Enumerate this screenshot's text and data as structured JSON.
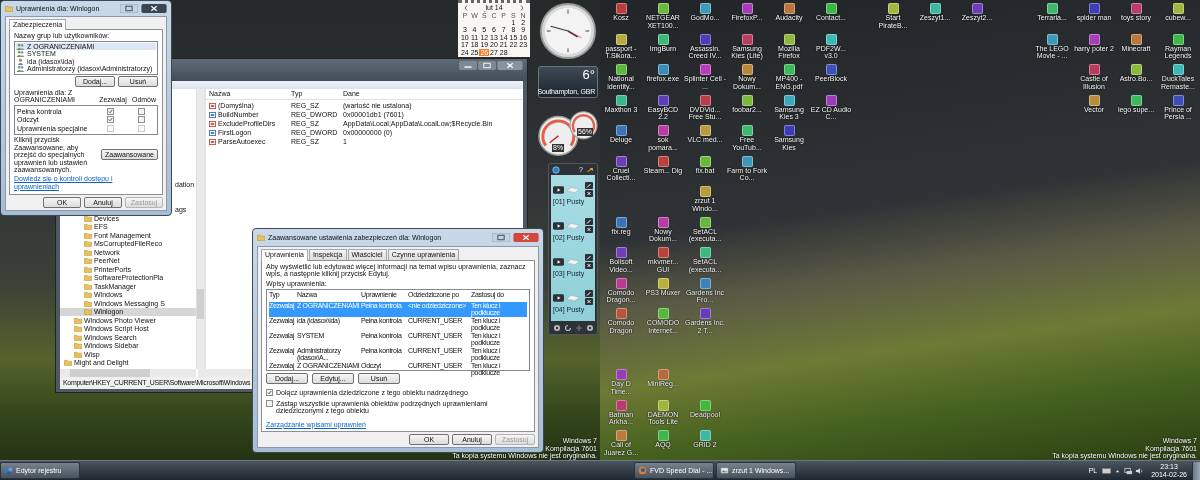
{
  "left_screen": {
    "gadgets": {
      "calendar": {
        "month": "lut 14",
        "weekdays": [
          "P",
          "W",
          "Ś",
          "C",
          "P",
          "S",
          "N"
        ],
        "weeks": [
          [
            {
              "day": "1",
              "today": false
            },
            {
              "day": "2",
              "today": false
            }
          ],
          [
            {
              "day": "3",
              "today": false
            },
            {
              "day": "4",
              "today": false
            },
            {
              "day": "5",
              "today": false
            },
            {
              "day": "6",
              "today": false
            },
            {
              "day": "7",
              "today": false
            },
            {
              "day": "8",
              "today": false
            },
            {
              "day": "9",
              "today": false
            }
          ],
          [
            {
              "day": "10",
              "today": false
            },
            {
              "day": "11",
              "today": false
            },
            {
              "day": "12",
              "today": false
            },
            {
              "day": "13",
              "today": false
            },
            {
              "day": "14",
              "today": false
            },
            {
              "day": "15",
              "today": false
            },
            {
              "day": "16",
              "today": false
            }
          ],
          [
            {
              "day": "17",
              "today": false
            },
            {
              "day": "18",
              "today": false
            },
            {
              "day": "19",
              "today": false
            },
            {
              "day": "20",
              "today": false
            },
            {
              "day": "21",
              "today": false
            },
            {
              "day": "22",
              "today": false
            },
            {
              "day": "23",
              "today": false
            }
          ],
          [
            {
              "day": "24",
              "today": false
            },
            {
              "day": "25",
              "today": false
            },
            {
              "day": "26",
              "today": true
            },
            {
              "day": "27",
              "today": false
            },
            {
              "day": "28",
              "today": false
            }
          ]
        ]
      },
      "weather": {
        "temperature": "6°",
        "location": "Southampton, GBR"
      },
      "cpu_meter": {
        "readings": [
          "8%",
          "56%"
        ]
      },
      "clipboard": {
        "help": "?",
        "slots": [
          "[01] Pusty",
          "[02] Pusty",
          "[03] Pusty",
          "[04] Pusty"
        ]
      }
    },
    "registry_editor": {
      "tree": [
        {
          "children": [
            {
              "children": [
                {
                  "label": "dation",
                  "kind": "partial",
                  "selected": false
                },
                {
                  "label": "ags",
                  "kind": "partial",
                  "selected": false
                },
                {
                  "label": "Devices",
                  "kind": "key",
                  "selected": false
                },
                {
                  "label": "EFS",
                  "kind": "key",
                  "selected": false
                },
                {
                  "label": "Font Management",
                  "kind": "key",
                  "selected": false
                },
                {
                  "label": "MsCorruptedFileReco",
                  "kind": "key",
                  "selected": false
                },
                {
                  "label": "Network",
                  "kind": "key",
                  "selected": false
                },
                {
                  "label": "PeerNet",
                  "kind": "key",
                  "selected": false
                },
                {
                  "label": "PrinterPorts",
                  "kind": "key",
                  "selected": false
                },
                {
                  "label": "SoftwareProtectionPla",
                  "kind": "key",
                  "selected": false
                },
                {
                  "label": "TaskManager",
                  "kind": "key",
                  "selected": false
                },
                {
                  "label": "Windows",
                  "kind": "key",
                  "selected": false
                },
                {
                  "label": "Windows Messaging S",
                  "kind": "key",
                  "selected": false
                },
                {
                  "label": "Winlogon",
                  "kind": "key",
                  "selected": true
                }
              ]
            },
            {
              "label": "Windows Photo Viewer",
              "kind": "key",
              "selected": false
            },
            {
              "label": "Windows Script Host",
              "kind": "key",
              "selected": false
            },
            {
              "label": "Windows Search",
              "kind": "key",
              "selected": false
            },
            {
              "label": "Windows Sidebar",
              "kind": "key",
              "selected": false
            },
            {
              "label": "Wisp",
              "kind": "key",
              "selected": false
            }
          ]
        },
        {
          "label": "Might and Delight",
          "kind": "key",
          "selected": false
        }
      ],
      "columns": [
        "Nazwa",
        "Typ",
        "Dane"
      ],
      "values": [
        {
          "kind": "sz",
          "name": "(Domyślna)",
          "type": "REG_SZ",
          "data": "(wartość nie ustalona)"
        },
        {
          "kind": "dword",
          "name": "BuildNumber",
          "type": "REG_DWORD",
          "data": "0x00001db1 (7601)"
        },
        {
          "kind": "sz",
          "name": "ExcludeProfileDirs",
          "type": "REG_SZ",
          "data": "AppData\\Local;AppData\\LocalLow;$Recycle.Bin"
        },
        {
          "kind": "dword",
          "name": "FirstLogon",
          "type": "REG_DWORD",
          "data": "0x00000000 (0)"
        },
        {
          "kind": "sz",
          "name": "ParseAutoexec",
          "type": "REG_SZ",
          "data": "1"
        }
      ],
      "status": "Komputer\\HKEY_CURRENT_USER\\Software\\Microsoft\\Windows"
    },
    "permissions_dialog": {
      "title": "Uprawnienia dla: Winlogon",
      "tabs": [
        {
          "label": "Zabezpieczenia",
          "selected": true
        }
      ],
      "principals_label": "Nazwy grup lub użytkowników:",
      "principals": [
        {
          "name": "Z OGRANICZENIAMI",
          "kind": "group",
          "selected": true
        },
        {
          "name": "SYSTEM",
          "kind": "group",
          "selected": false
        },
        {
          "name": "ida (idasox\\ida)",
          "kind": "user",
          "selected": false
        },
        {
          "name": "Administratorzy (idasox\\Administratorzy)",
          "kind": "group",
          "selected": false
        }
      ],
      "list_buttons": [
        "Dodaj...",
        "Usuń"
      ],
      "permissions_label": "Uprawnienia dla: Z OGRANICZENIAMI",
      "allow_label": "Zezwalaj",
      "deny_label": "Odmów",
      "permissions": [
        {
          "name": "Pełna kontrola",
          "allow": true,
          "deny": false,
          "disabled": false
        },
        {
          "name": "Odczyt",
          "allow": true,
          "deny": false,
          "disabled": false
        },
        {
          "name": "Uprawnienia specjalne",
          "allow": false,
          "deny": false,
          "disabled": true
        }
      ],
      "advanced_note": "Kliknij przycisk Zaawansowane, aby przejść do specjalnych uprawnień lub ustawień zaawansowanych.",
      "advanced_button": "Zaawansowane",
      "help_link": "Dowiedz się o kontroli dostępu i uprawnieniach",
      "buttons": [
        {
          "label": "OK",
          "disabled": false
        },
        {
          "label": "Anuluj",
          "disabled": false
        },
        {
          "label": "Zastosuj",
          "disabled": true
        }
      ]
    },
    "advanced_dialog": {
      "title": "Zaawansowane ustawienia zabezpieczeń dla: Winlogon",
      "tabs": [
        {
          "label": "Uprawnienia",
          "selected": true
        },
        {
          "label": "Inspekcja",
          "selected": false
        },
        {
          "label": "Właściciel",
          "selected": false
        },
        {
          "label": "Czynne uprawnienia",
          "selected": false
        }
      ],
      "intro": "Aby wyświetlić lub edytować więcej informacji na temat wpisu uprawnienia, zaznacz wpis, a następnie kliknij przycisk Edytuj.",
      "entries_label": "Wpisy uprawnienia:",
      "columns": [
        "Typ",
        "Nazwa",
        "Uprawnienie",
        "Odziedziczone po",
        "Zastosuj do"
      ],
      "entries": [
        {
          "cells": [
            "Zezwalaj",
            "Z OGRANICZENIAMI",
            "Pełna kontrola",
            "<nie odziedziczone>",
            "Ten klucz i podklucze"
          ],
          "selected": true
        },
        {
          "cells": [
            "Zezwalaj",
            "ida (idasox\\ida)",
            "Pełna kontrola",
            "CURRENT_USER",
            "Ten klucz i podklucze"
          ],
          "selected": false
        },
        {
          "cells": [
            "Zezwalaj",
            "SYSTEM",
            "Pełna kontrola",
            "CURRENT_USER",
            "Ten klucz i podklucze"
          ],
          "selected": false
        },
        {
          "cells": [
            "Zezwalaj",
            "Administratorzy (idasox\\A...",
            "Pełna kontrola",
            "CURRENT_USER",
            "Ten klucz i podklucze"
          ],
          "selected": false
        },
        {
          "cells": [
            "Zezwalaj",
            "Z OGRANICZENIAMI",
            "Odczyt",
            "CURRENT_USER",
            "Ten klucz i podklucze"
          ],
          "selected": false
        }
      ],
      "entry_buttons": [
        "Dodaj...",
        "Edytuj...",
        "Usuń"
      ],
      "options": [
        {
          "label": "Dołącz uprawnienia dziedziczone z tego obiektu nadrzędnego",
          "checked": true
        },
        {
          "label": "Zastąp wszystkie uprawnienia obiektów podrzędnych uprawnieniami dziedziczonymi z tego obiektu",
          "checked": false
        }
      ],
      "link": "Zarządzanie wpisami uprawnień",
      "buttons": [
        {
          "label": "OK",
          "disabled": false
        },
        {
          "label": "Anuluj",
          "disabled": false
        },
        {
          "label": "Zastosuj",
          "disabled": true
        }
      ]
    },
    "os_notice": [
      "Windows 7",
      "Kompilacja 7601",
      "Ta kopia systemu Windows nie jest oryginalna."
    ],
    "taskbar": {
      "buttons": [
        {
          "label": "Edytor rejestru",
          "selected": false
        }
      ]
    }
  },
  "right_screen": {
    "icon_groups": [
      {
        "bottom_aligned": false,
        "columns": [
          [
            "Kosz",
            "passport - T.Sikora...",
            "National identity...",
            "Maxthon 3",
            "Deluge",
            "Cruel Collecti..."
          ],
          [
            "NETGEAR XET100...",
            "ImgBurn",
            "firefox.exe",
            "EasyBCD 2.2",
            "sok pomara...",
            "Steam... Dig"
          ],
          [
            "GodMo...",
            "Assassin. Creed IV...",
            "Splinter Cell - ...",
            "DVDVid... Free Stu...",
            "VLC med...",
            "fix.bat"
          ],
          [
            "FirefoxP...",
            "Samsung Kies (Lite)",
            "Nowy Dokum...",
            "foobar2...",
            "Free YouTub...",
            "Farm to Fork Co..."
          ],
          [
            "Audacity",
            "Mozilla Firefox",
            "MP400 -ENG.pdf",
            "Samsung Kies 3",
            "Samsung Kies"
          ],
          [
            "Contact...",
            "PDF2W... v3.0",
            "PeerBlock",
            "EZ CD Audio C..."
          ]
        ]
      },
      {
        "columns": [
          [
            "Start PirateB..."
          ],
          [
            "Zeszyt1..."
          ],
          [
            "Zeszyt2..."
          ]
        ]
      },
      {
        "bottom_aligned": false,
        "columns": [
          [
            "Terraria...",
            "The LEGO Movie - ..."
          ],
          [
            "spider man",
            "harry poter 2",
            "Castle of Illusion",
            "Vector"
          ],
          [
            "toys story",
            "Minecraft",
            "Astro.Bo...",
            "lego supe..."
          ],
          [
            "cubew...",
            "Rayman Legends",
            "DuckTales Remaste...",
            "Prince of Persia ..."
          ]
        ]
      },
      {
        "bottom_aligned": true,
        "columns": [
          [
            "fix.reg",
            "Boilsoft Video...",
            "Comodo Dragon...",
            "Comodo Dragon"
          ],
          [
            "Nowy Dokum...",
            "mkvmer... GUI",
            "PS3 Muxer",
            "COMODO Internet..."
          ],
          [
            "zrzut 1 Windo...",
            "SetACL (executa...",
            "SetACL (executa...",
            "Gardens Inc Fro...",
            "Gardens Inc. 2 T..."
          ]
        ]
      },
      {
        "bottom_aligned": true,
        "columns": [
          [
            "Day D Time...",
            "Batman Arkha...",
            "Call of Juarez G..."
          ],
          [
            "MiniReg...",
            "DAEMON Tools Lite",
            "AQQ"
          ],
          [
            "Deadpool",
            "GRID 2"
          ]
        ]
      }
    ],
    "os_notice": [
      "Windows 7",
      "Kompilacja 7601",
      "Ta kopia systemu Windows nie jest oryginalna."
    ],
    "taskbar": {
      "buttons": [
        {
          "label": "FVD Speed Dial - ...",
          "selected": false
        },
        {
          "label": "zrzut 1 Windows...",
          "selected": false
        }
      ],
      "language": "PL",
      "time": "23:13",
      "date": "2014-02-26"
    }
  }
}
